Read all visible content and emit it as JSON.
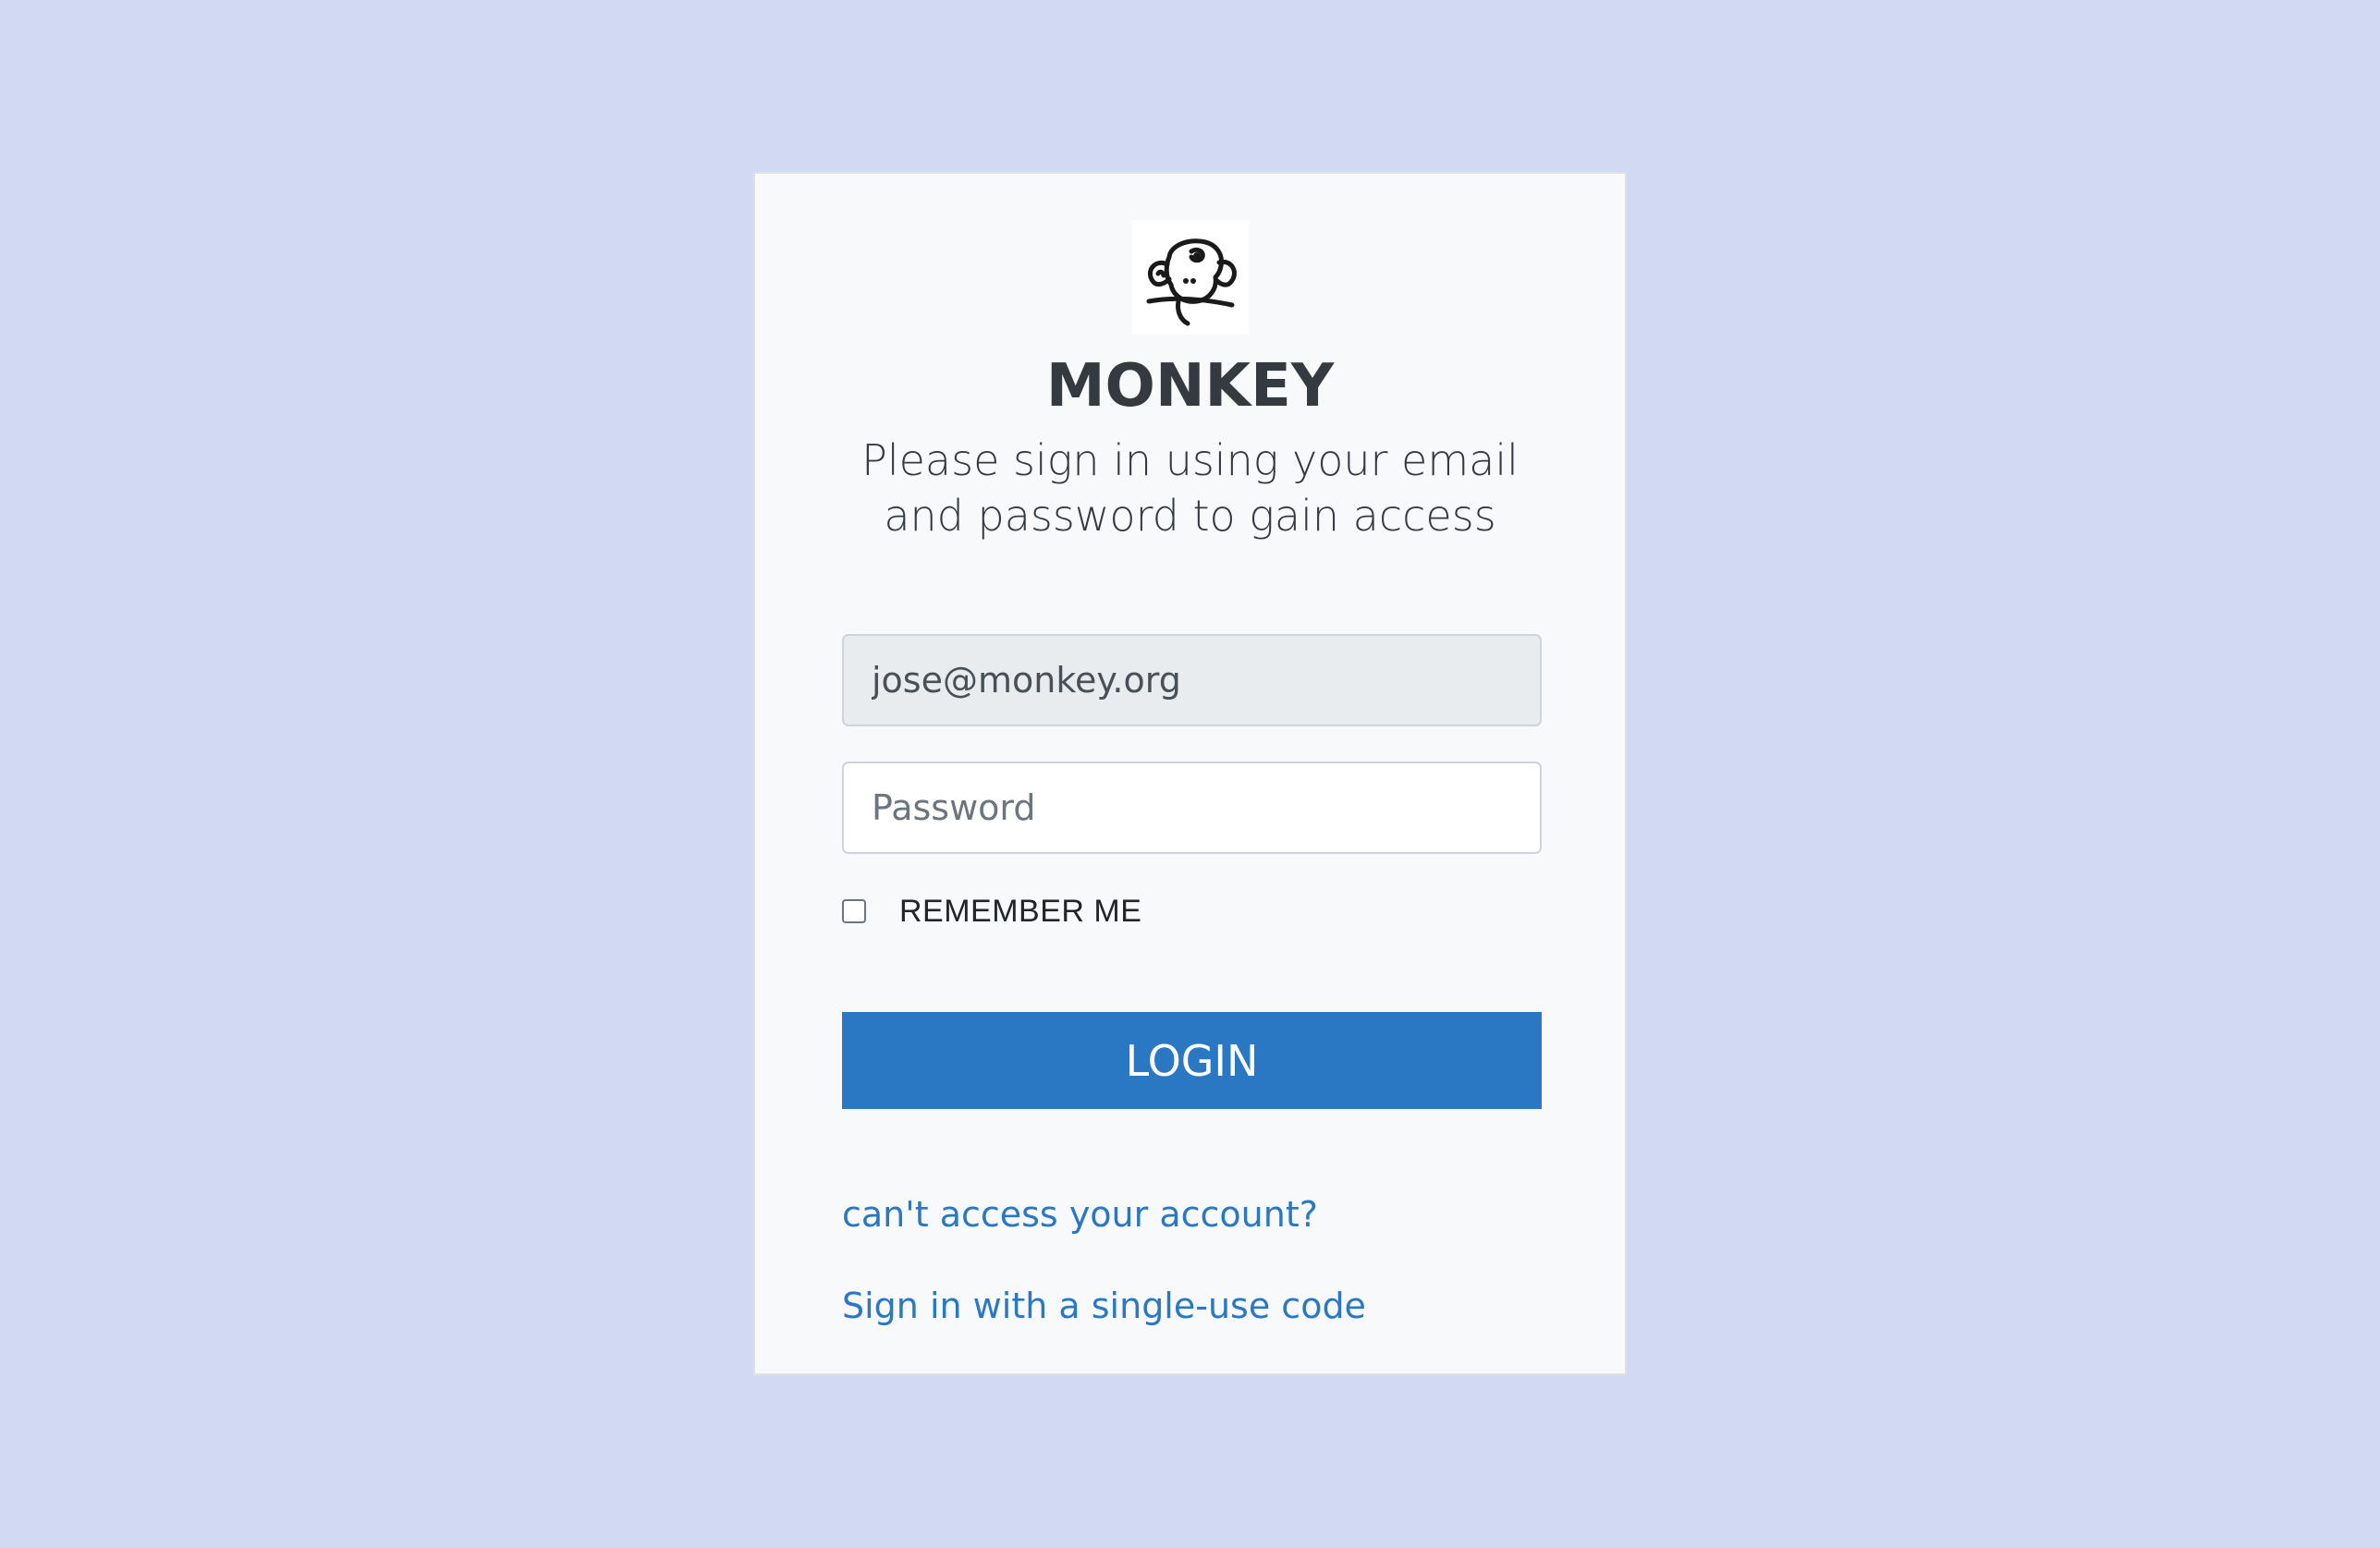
{
  "brand": {
    "logo_icon": "monkey-face-icon",
    "name": "MONKEY"
  },
  "subtitle": "Please sign in using your email and password to gain access",
  "form": {
    "email_value": "jose@monkey.org",
    "password_placeholder": "Password",
    "remember_label": "REMEMBER ME",
    "remember_checked": false,
    "login_label": "LOGIN"
  },
  "links": {
    "cant_access": "can't access your account?",
    "single_use_code": "Sign in with a single-use code"
  },
  "colors": {
    "background": "#d2d9f3",
    "card": "#f8f9fa",
    "primary": "#2a77c4",
    "text_dark": "#343a40"
  }
}
